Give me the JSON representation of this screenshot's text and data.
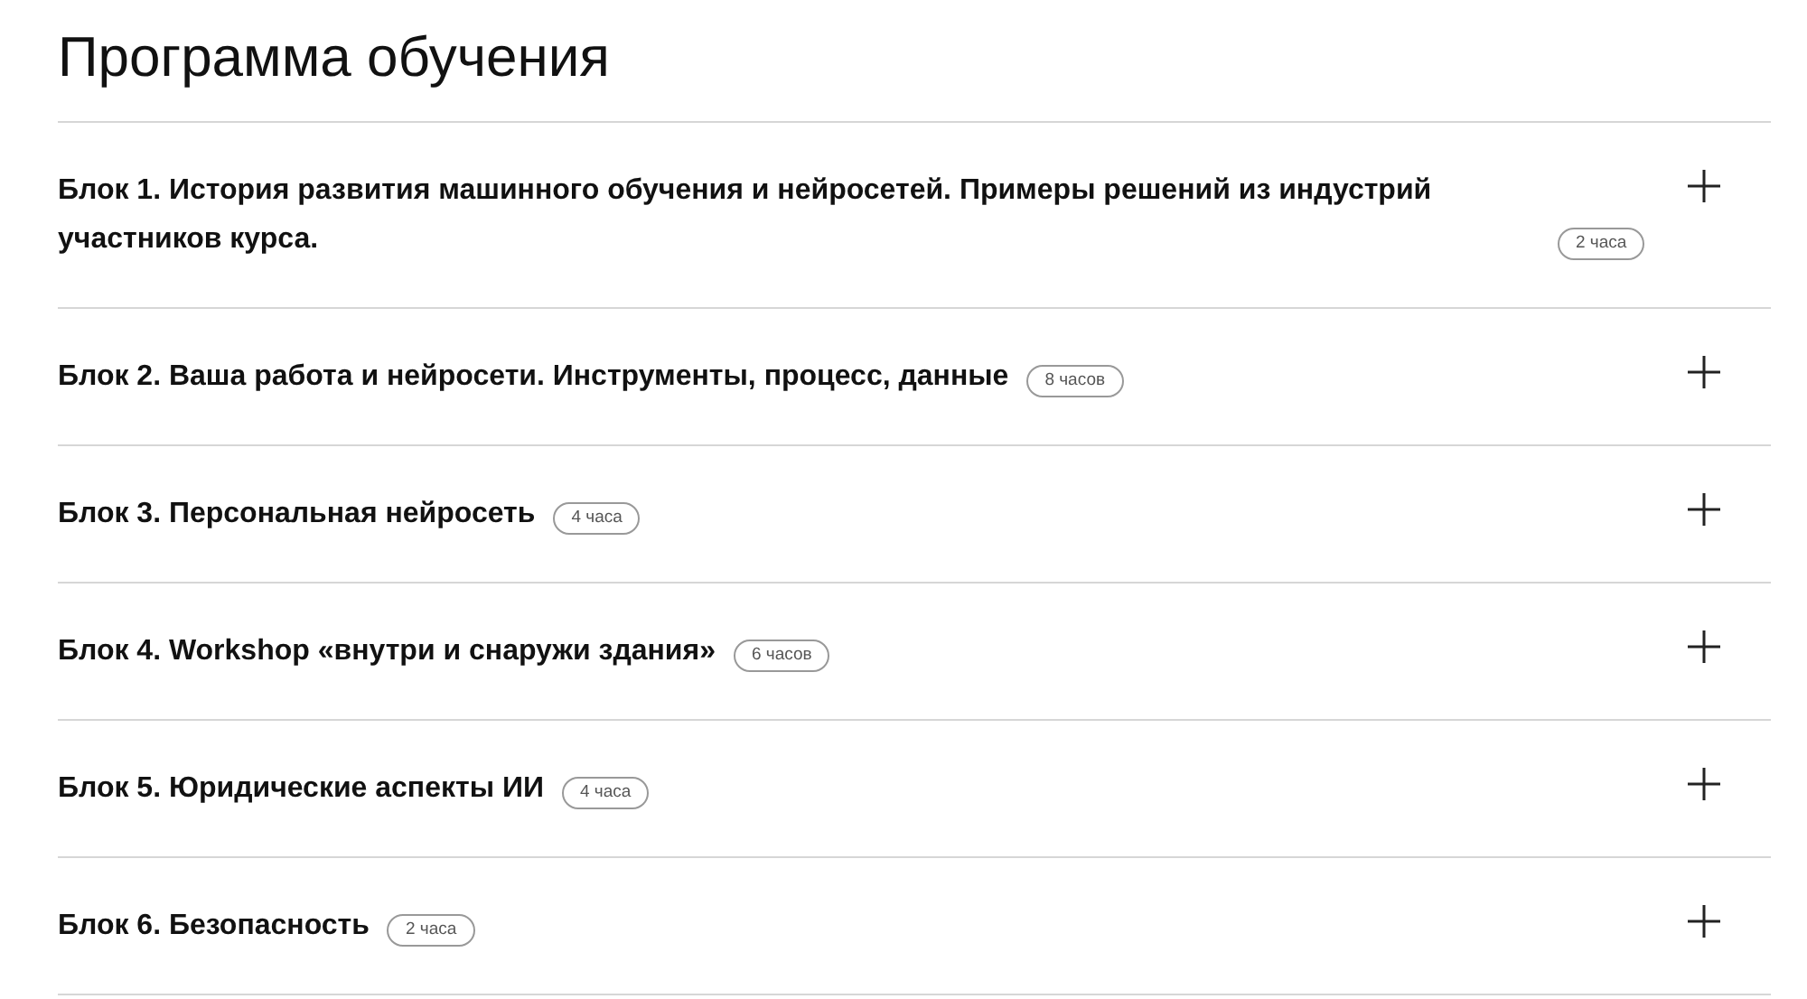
{
  "title": "Программа обучения",
  "blocks": [
    {
      "label": "Блок 1. История развития машинного обучения и нейросетей. Примеры решений из индустрий участников курса.",
      "duration": "2 часа",
      "expanded": false
    },
    {
      "label": "Блок 2. Ваша работа и нейросети. Инструменты, процесс, данные",
      "duration": "8 часов",
      "expanded": false
    },
    {
      "label": "Блок 3. Персональная нейросеть",
      "duration": "4 часа",
      "expanded": false
    },
    {
      "label": "Блок 4. Workshop «внутри и снаружи здания»",
      "duration": "6 часов",
      "expanded": false
    },
    {
      "label": "Блок 5. Юридические аспекты ИИ",
      "duration": "4 часа",
      "expanded": false
    },
    {
      "label": "Блок 6. Безопасность",
      "duration": "2 часа",
      "expanded": false
    }
  ]
}
